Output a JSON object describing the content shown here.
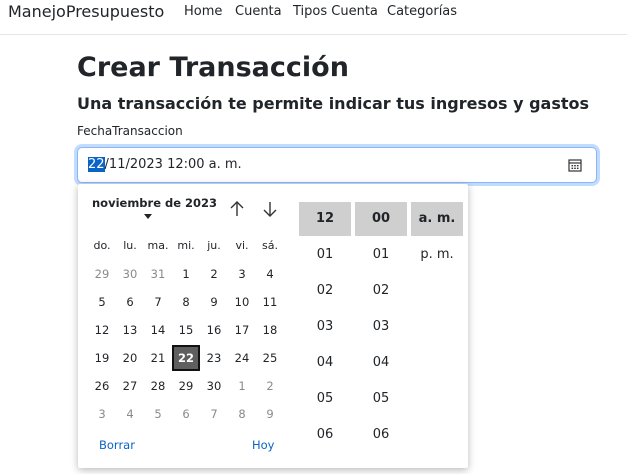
{
  "navbar": {
    "brand": "ManejoPresupuesto",
    "links": [
      "Home",
      "Cuenta",
      "Tipos Cuenta",
      "Categorías"
    ]
  },
  "page": {
    "title": "Crear Transacción",
    "subtitle": "Una transacción te permite indicar tus ingresos y gastos",
    "field_label": "FechaTransaccion"
  },
  "input": {
    "selected_part": "22",
    "rest_value": "/11/2023 12:00 a. m.",
    "icon": "calendar-icon"
  },
  "picker": {
    "month_label": "noviembre de 2023",
    "weekdays": [
      "do.",
      "lu.",
      "ma.",
      "mi.",
      "ju.",
      "vi.",
      "sá."
    ],
    "weeks": [
      [
        "29",
        "30",
        "31",
        "1",
        "2",
        "3",
        "4"
      ],
      [
        "5",
        "6",
        "7",
        "8",
        "9",
        "10",
        "11"
      ],
      [
        "12",
        "13",
        "14",
        "15",
        "16",
        "17",
        "18"
      ],
      [
        "19",
        "20",
        "21",
        "22",
        "23",
        "24",
        "25"
      ],
      [
        "26",
        "27",
        "28",
        "29",
        "30",
        "1",
        "2"
      ],
      [
        "3",
        "4",
        "5",
        "6",
        "7",
        "8",
        "9"
      ]
    ],
    "clear_label": "Borrar",
    "today_label": "Hoy",
    "hour_header": "12",
    "minute_header": "00",
    "ampm_header": "a. m.",
    "hours": [
      "01",
      "02",
      "03",
      "04",
      "05",
      "06"
    ],
    "minutes": [
      "01",
      "02",
      "03",
      "04",
      "05",
      "06"
    ],
    "ampm_options": [
      "p. m."
    ]
  }
}
